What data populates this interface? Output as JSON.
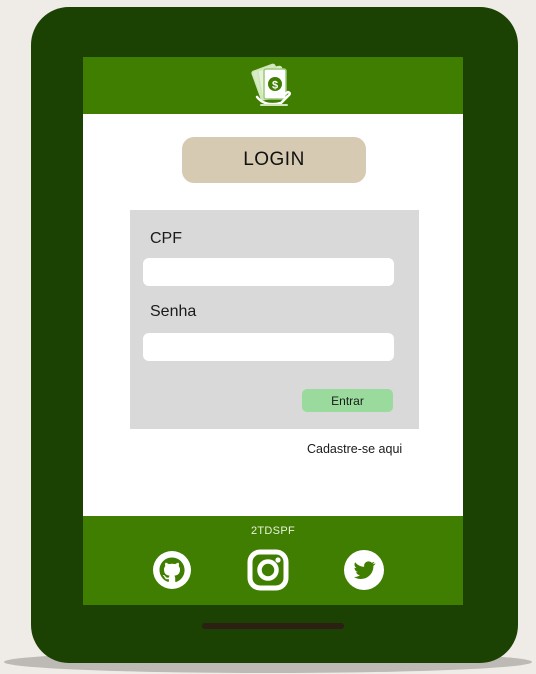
{
  "header": {
    "logo_icon": "money-cash-logo-icon"
  },
  "login_title": "LOGIN",
  "form": {
    "cpf_label": "CPF",
    "cpf_value": "",
    "senha_label": "Senha",
    "senha_value": "",
    "submit_label": "Entrar"
  },
  "register_link": "Cadastre-se aqui",
  "footer": {
    "label": "2TDSPF",
    "social_icons": [
      "github-icon",
      "instagram-icon",
      "twitter-icon"
    ]
  },
  "colors": {
    "device_frame": "#1b4203",
    "header_footer": "#3f7e00",
    "title_box": "#d7cab2",
    "form_panel": "#d9d9d9",
    "submit_button": "#9adb9d",
    "background": "#efebe6"
  }
}
